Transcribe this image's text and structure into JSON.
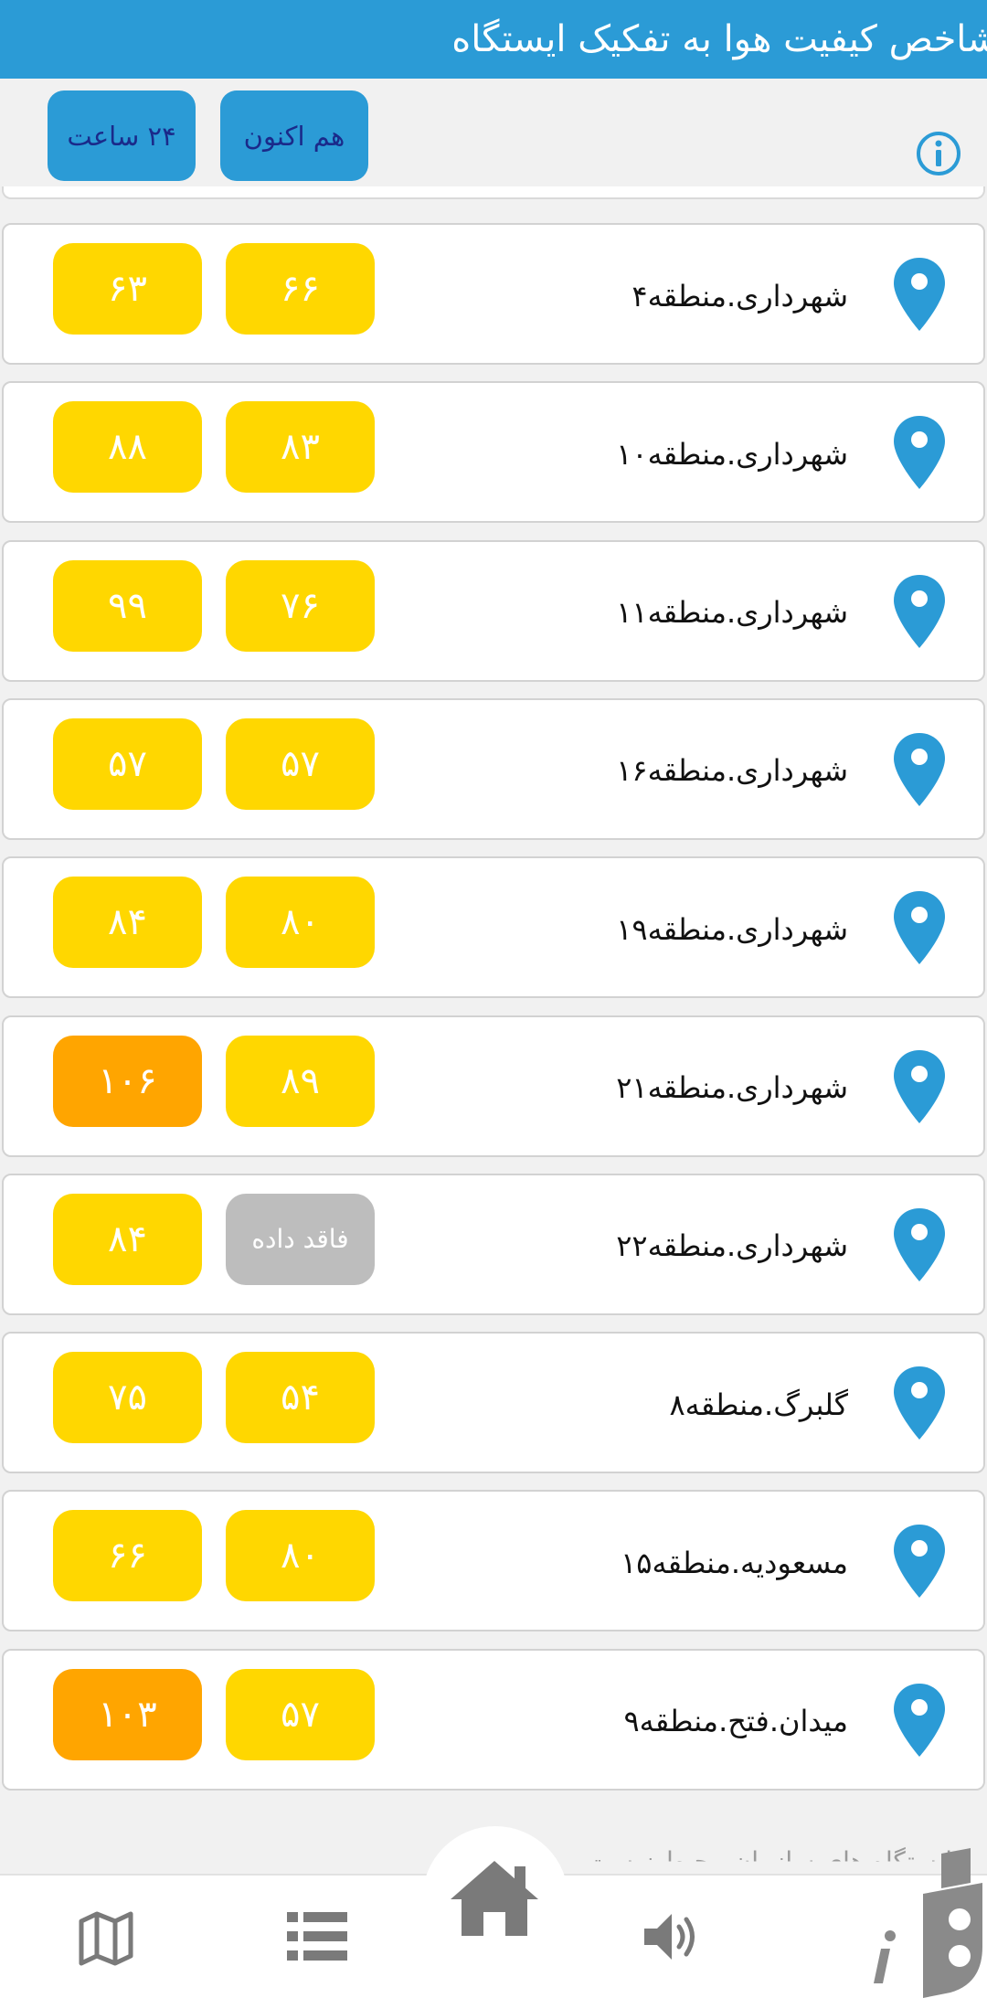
{
  "header": {
    "title": "شاخص کیفیت هوا به تفکیک ایستگاه"
  },
  "toolbar": {
    "btn_24h": "۲۴ ساعت",
    "btn_now": "هم اکنون"
  },
  "colors": {
    "accent": "#2b9bd6",
    "yellow": "#ffd700",
    "orange": "#ffa500",
    "gray": "#bdbdbd"
  },
  "stations": [
    {
      "name": "شهرداری.منطقه۴",
      "now": "۶۶",
      "now_color": "#ffd700",
      "day": "۶۳",
      "day_color": "#ffd700"
    },
    {
      "name": "شهرداری.منطقه۱۰",
      "now": "۸۳",
      "now_color": "#ffd700",
      "day": "۸۸",
      "day_color": "#ffd700"
    },
    {
      "name": "شهرداری.منطقه۱۱",
      "now": "۷۶",
      "now_color": "#ffd700",
      "day": "۹۹",
      "day_color": "#ffd700"
    },
    {
      "name": "شهرداری.منطقه۱۶",
      "now": "۵۷",
      "now_color": "#ffd700",
      "day": "۵۷",
      "day_color": "#ffd700"
    },
    {
      "name": "شهرداری.منطقه۱۹",
      "now": "۸۰",
      "now_color": "#ffd700",
      "day": "۸۴",
      "day_color": "#ffd700"
    },
    {
      "name": "شهرداری.منطقه۲۱",
      "now": "۸۹",
      "now_color": "#ffd700",
      "day": "۱۰۶",
      "day_color": "#ffa500"
    },
    {
      "name": "شهرداری.منطقه۲۲",
      "now": "فاقد داده",
      "now_color": "#bdbdbd",
      "day": "۸۴",
      "day_color": "#ffd700"
    },
    {
      "name": "گلبرگ.منطقه۸",
      "now": "۵۴",
      "now_color": "#ffd700",
      "day": "۷۵",
      "day_color": "#ffd700"
    },
    {
      "name": "مسعودیه.منطقه۱۵",
      "now": "۸۰",
      "now_color": "#ffd700",
      "day": "۶۶",
      "day_color": "#ffd700"
    },
    {
      "name": "میدان.فتح.منطقه۹",
      "now": "۵۷",
      "now_color": "#ffd700",
      "day": "۱۰۳",
      "day_color": "#ffa500"
    }
  ],
  "footer": {
    "text": "ایستگاه های سازمان محیط زیست"
  },
  "nav": [
    "map-icon",
    "list-icon",
    "home-icon",
    "sound-icon",
    "app-logo"
  ]
}
